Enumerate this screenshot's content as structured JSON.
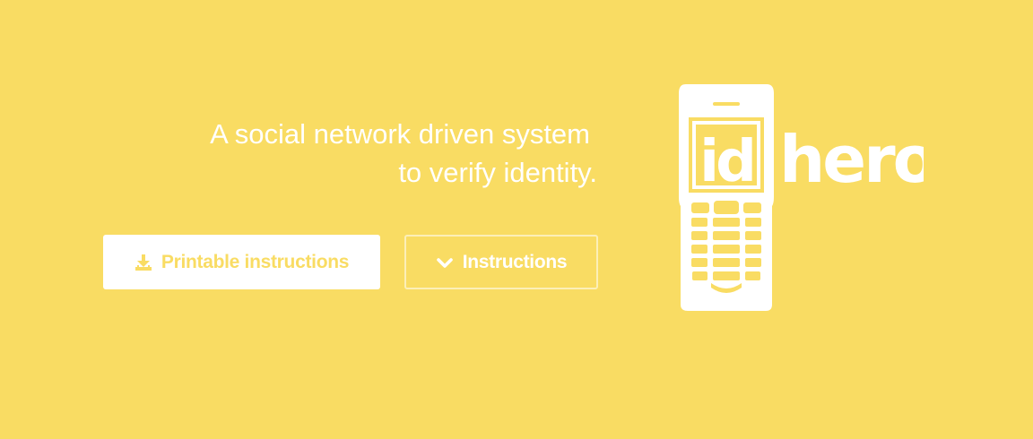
{
  "hero": {
    "tagline_line1": "A social network driven system",
    "tagline_line2": "to verify identity."
  },
  "buttons": {
    "printable_label": "Printable instructions",
    "printable_icon": "download-icon",
    "instructions_label": "Instructions",
    "instructions_icon": "chevron-down-icon"
  },
  "logo": {
    "text": "idhero",
    "icon": "phone-icon"
  },
  "colors": {
    "background": "#f9dc63",
    "foreground": "#ffffff"
  }
}
